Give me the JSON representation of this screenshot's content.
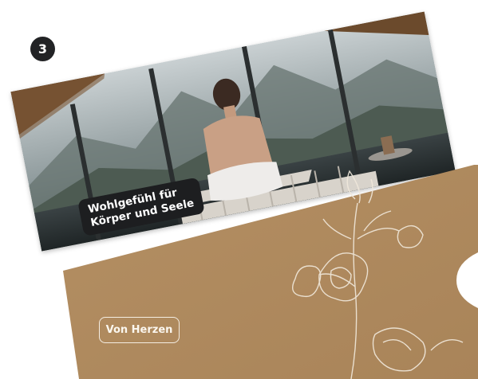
{
  "step": {
    "number": "3"
  },
  "card": {
    "caption": "Wohlgefühl für\nKörper und Seele"
  },
  "envelope": {
    "label": "Von Herzen"
  },
  "colors": {
    "kraft": "#b08a5e",
    "badge": "#222325",
    "caption_bg": "#1d1e20"
  }
}
